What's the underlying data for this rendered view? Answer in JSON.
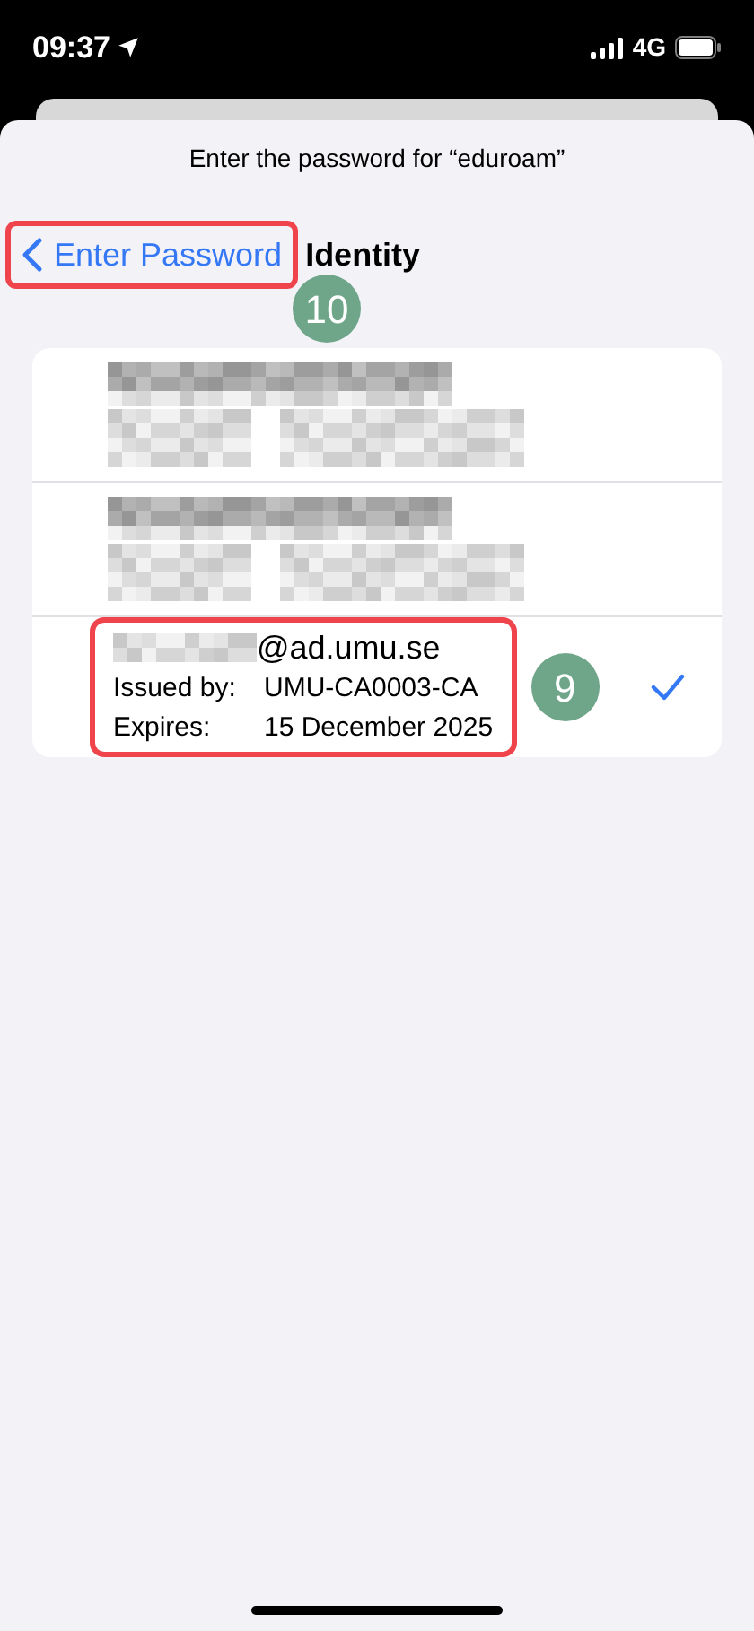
{
  "status_bar": {
    "time": "09:37",
    "network": "4G"
  },
  "sheet": {
    "prompt": "Enter the password for “eduroam”",
    "back_button": {
      "label": "Enter Password",
      "highlighted": true,
      "badge": "10"
    },
    "title": "Identity",
    "identities": [
      {
        "kind": "redacted",
        "selected": false
      },
      {
        "kind": "redacted",
        "selected": false
      },
      {
        "kind": "certificate",
        "selected": true,
        "highlighted": true,
        "badge": "9",
        "email_suffix": "@ad.umu.se",
        "issued_by_label": "Issued by:",
        "issued_by": "UMU-CA0003-CA",
        "expires_label": "Expires:",
        "expires": "15 December 2025"
      }
    ]
  }
}
